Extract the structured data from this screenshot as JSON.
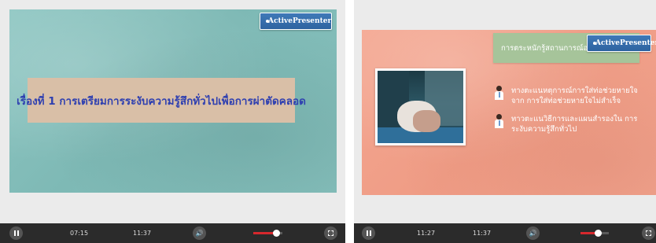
{
  "left_player": {
    "brand": "ActivePresenter",
    "slide_title": "เรื่องที่ 1 การเตรียมการระงับความรู้สึกทั่วไปเพื่อการผ่าตัดคลอด",
    "current_time": "07:15",
    "duration": "11:37",
    "volume": 0.78
  },
  "right_player": {
    "brand": "ActivePresenter",
    "header": "การตระหนักรู้สถานการณ์อ",
    "bullets": [
      "ทางตะแนหตุการณ์การใส่ท่อช่วยหายใจจาก การใส่ท่อช่วยหายใจไม่สำเร็จ",
      "ทาวตะแนวิธีการและแผนสำรองใน การระงับความรู้สึกทั่วไป"
    ],
    "current_time": "11:27",
    "duration": "11:37",
    "volume": 0.6
  },
  "icons": {
    "play_pause": "pause-icon",
    "volume": "volume-icon",
    "fullscreen": "fullscreen-icon",
    "brand": "activepresenter-logo-icon",
    "bullet": "doctor-icon"
  },
  "colors": {
    "teal_slide": "#86c0bc",
    "salmon_slide": "#f2a48e",
    "title_text": "#2e3fb0",
    "progress": "#d6282d",
    "controls_bg": "#2b2b2b"
  }
}
